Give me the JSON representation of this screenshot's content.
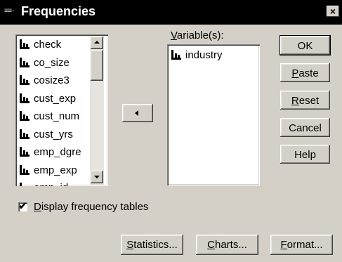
{
  "window": {
    "title": "Frequencies",
    "icon_text": "≡≡·",
    "close_label": "×"
  },
  "source_list": {
    "items": [
      "check",
      "co_size",
      "cosize3",
      "cust_exp",
      "cust_num",
      "cust_yrs",
      "emp_dgre",
      "emp_exp",
      "emp_id"
    ]
  },
  "transfer_button": {
    "icon": "left-arrow-icon"
  },
  "variables": {
    "label_prefix": "",
    "label_mnemonic": "V",
    "label_rest": "ariable(s):",
    "items": [
      "industry"
    ]
  },
  "buttons": {
    "ok": {
      "mnemonic": "",
      "rest": "OK"
    },
    "paste": {
      "mnemonic": "P",
      "rest": "aste"
    },
    "reset": {
      "mnemonic": "R",
      "rest": "eset"
    },
    "cancel": {
      "mnemonic": "",
      "rest": "Cancel"
    },
    "help": {
      "mnemonic": "",
      "rest": "Help"
    },
    "statistics": {
      "mnemonic": "S",
      "rest": "tatistics..."
    },
    "charts": {
      "mnemonic": "C",
      "rest": "harts..."
    },
    "format": {
      "mnemonic": "F",
      "rest": "ormat..."
    }
  },
  "display_checkbox": {
    "checked": true,
    "check_glyph": "✔",
    "mnemonic": "D",
    "rest": "isplay frequency tables"
  }
}
